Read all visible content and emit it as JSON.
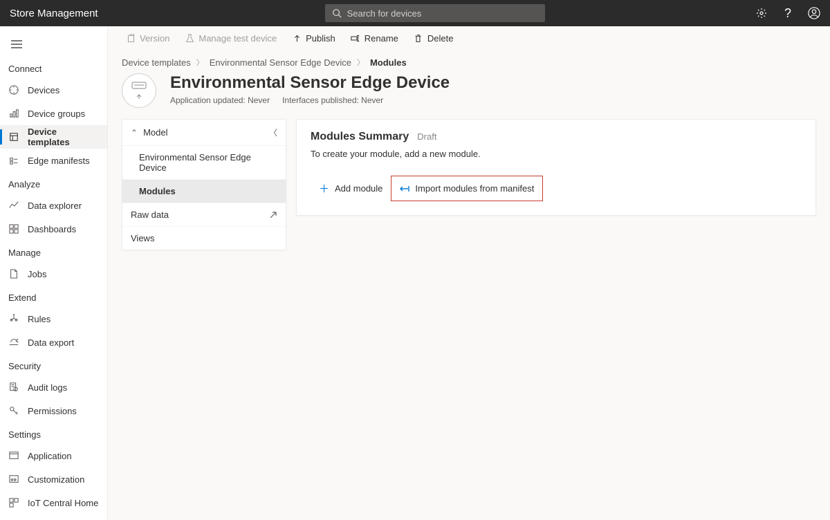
{
  "header": {
    "app_title": "Store Management",
    "search_placeholder": "Search for devices"
  },
  "sidebar": {
    "sections": [
      {
        "title": "Connect",
        "items": [
          {
            "icon": "compass",
            "label": "Devices"
          },
          {
            "icon": "bar-chart",
            "label": "Device groups"
          },
          {
            "icon": "template",
            "label": "Device templates",
            "active": true
          },
          {
            "icon": "manifest",
            "label": "Edge manifests"
          }
        ]
      },
      {
        "title": "Analyze",
        "items": [
          {
            "icon": "line-chart",
            "label": "Data explorer"
          },
          {
            "icon": "dashboard",
            "label": "Dashboards"
          }
        ]
      },
      {
        "title": "Manage",
        "items": [
          {
            "icon": "jobs",
            "label": "Jobs"
          }
        ]
      },
      {
        "title": "Extend",
        "items": [
          {
            "icon": "rules",
            "label": "Rules"
          },
          {
            "icon": "export",
            "label": "Data export"
          }
        ]
      },
      {
        "title": "Security",
        "items": [
          {
            "icon": "audit",
            "label": "Audit logs"
          },
          {
            "icon": "key",
            "label": "Permissions"
          }
        ]
      },
      {
        "title": "Settings",
        "items": [
          {
            "icon": "app",
            "label": "Application"
          },
          {
            "icon": "custom",
            "label": "Customization"
          },
          {
            "icon": "home",
            "label": "IoT Central Home"
          }
        ]
      }
    ]
  },
  "commands": {
    "version": "Version",
    "manage_test": "Manage test device",
    "publish": "Publish",
    "rename": "Rename",
    "delete": "Delete"
  },
  "breadcrumb": {
    "crumb1": "Device templates",
    "crumb2": "Environmental Sensor Edge Device",
    "crumb3": "Modules"
  },
  "page": {
    "title": "Environmental Sensor Edge Device",
    "meta_app": "Application updated: Never",
    "meta_int": "Interfaces published: Never"
  },
  "tree": {
    "root": "Model",
    "node_device": "Environmental Sensor Edge Device",
    "node_modules": "Modules",
    "node_raw": "Raw data",
    "node_views": "Views"
  },
  "panel": {
    "title": "Modules Summary",
    "draft": "Draft",
    "desc": "To create your module, add a new module.",
    "add": "Add module",
    "import": "Import modules from manifest"
  }
}
